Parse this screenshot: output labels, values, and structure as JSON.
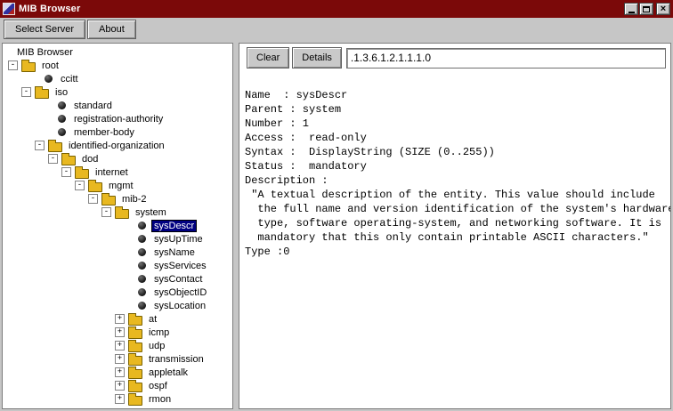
{
  "colors": {
    "titlebar": "#7b0909",
    "selection": "#000080",
    "folder": "#e8b820"
  },
  "window": {
    "title": "MIB Browser"
  },
  "toolbar": {
    "select_server_label": "Select Server",
    "about_label": "About"
  },
  "tree": {
    "nodes": [
      {
        "label": "MIB Browser",
        "depth": 0,
        "type": "text"
      },
      {
        "label": "root",
        "depth": 0,
        "type": "folder",
        "expander": "-"
      },
      {
        "label": "ccitt",
        "depth": 1,
        "type": "leaf"
      },
      {
        "label": "iso",
        "depth": 1,
        "type": "folder",
        "expander": "-"
      },
      {
        "label": "standard",
        "depth": 2,
        "type": "leaf"
      },
      {
        "label": "registration-authority",
        "depth": 2,
        "type": "leaf"
      },
      {
        "label": "member-body",
        "depth": 2,
        "type": "leaf"
      },
      {
        "label": "identified-organization",
        "depth": 2,
        "type": "folder",
        "expander": "-"
      },
      {
        "label": "dod",
        "depth": 3,
        "type": "folder",
        "expander": "-"
      },
      {
        "label": "internet",
        "depth": 4,
        "type": "folder",
        "expander": "-"
      },
      {
        "label": "mgmt",
        "depth": 5,
        "type": "folder",
        "expander": "-"
      },
      {
        "label": "mib-2",
        "depth": 6,
        "type": "folder",
        "expander": "-"
      },
      {
        "label": "system",
        "depth": 7,
        "type": "folder",
        "expander": "-"
      },
      {
        "label": "sysDescr",
        "depth": 8,
        "type": "leaf",
        "selected": true
      },
      {
        "label": "sysUpTime",
        "depth": 8,
        "type": "leaf"
      },
      {
        "label": "sysName",
        "depth": 8,
        "type": "leaf"
      },
      {
        "label": "sysServices",
        "depth": 8,
        "type": "leaf"
      },
      {
        "label": "sysContact",
        "depth": 8,
        "type": "leaf"
      },
      {
        "label": "sysObjectID",
        "depth": 8,
        "type": "leaf"
      },
      {
        "label": "sysLocation",
        "depth": 8,
        "type": "leaf"
      },
      {
        "label": "at",
        "depth": 8,
        "type": "folder",
        "expander": "+"
      },
      {
        "label": "icmp",
        "depth": 8,
        "type": "folder",
        "expander": "+"
      },
      {
        "label": "udp",
        "depth": 8,
        "type": "folder",
        "expander": "+"
      },
      {
        "label": "transmission",
        "depth": 8,
        "type": "folder",
        "expander": "+"
      },
      {
        "label": "appletalk",
        "depth": 8,
        "type": "folder",
        "expander": "+"
      },
      {
        "label": "ospf",
        "depth": 8,
        "type": "folder",
        "expander": "+"
      },
      {
        "label": "rmon",
        "depth": 8,
        "type": "folder",
        "expander": "+"
      }
    ]
  },
  "detail": {
    "clear_label": "Clear",
    "details_label": "Details",
    "oid_value": ".1.3.6.1.2.1.1.1.0",
    "lines": [
      "Name  : sysDescr",
      "Parent : system",
      "Number : 1",
      "Access :  read-only",
      "Syntax :  DisplayString (SIZE (0..255))",
      "Status :  mandatory",
      "Description : ",
      " \"A textual description of the entity. This value should include",
      "  the full name and version identification of the system's hardware",
      "  type, software operating-system, and networking software. It is",
      "  mandatory that this only contain printable ASCII characters.\"",
      "Type :0"
    ]
  }
}
